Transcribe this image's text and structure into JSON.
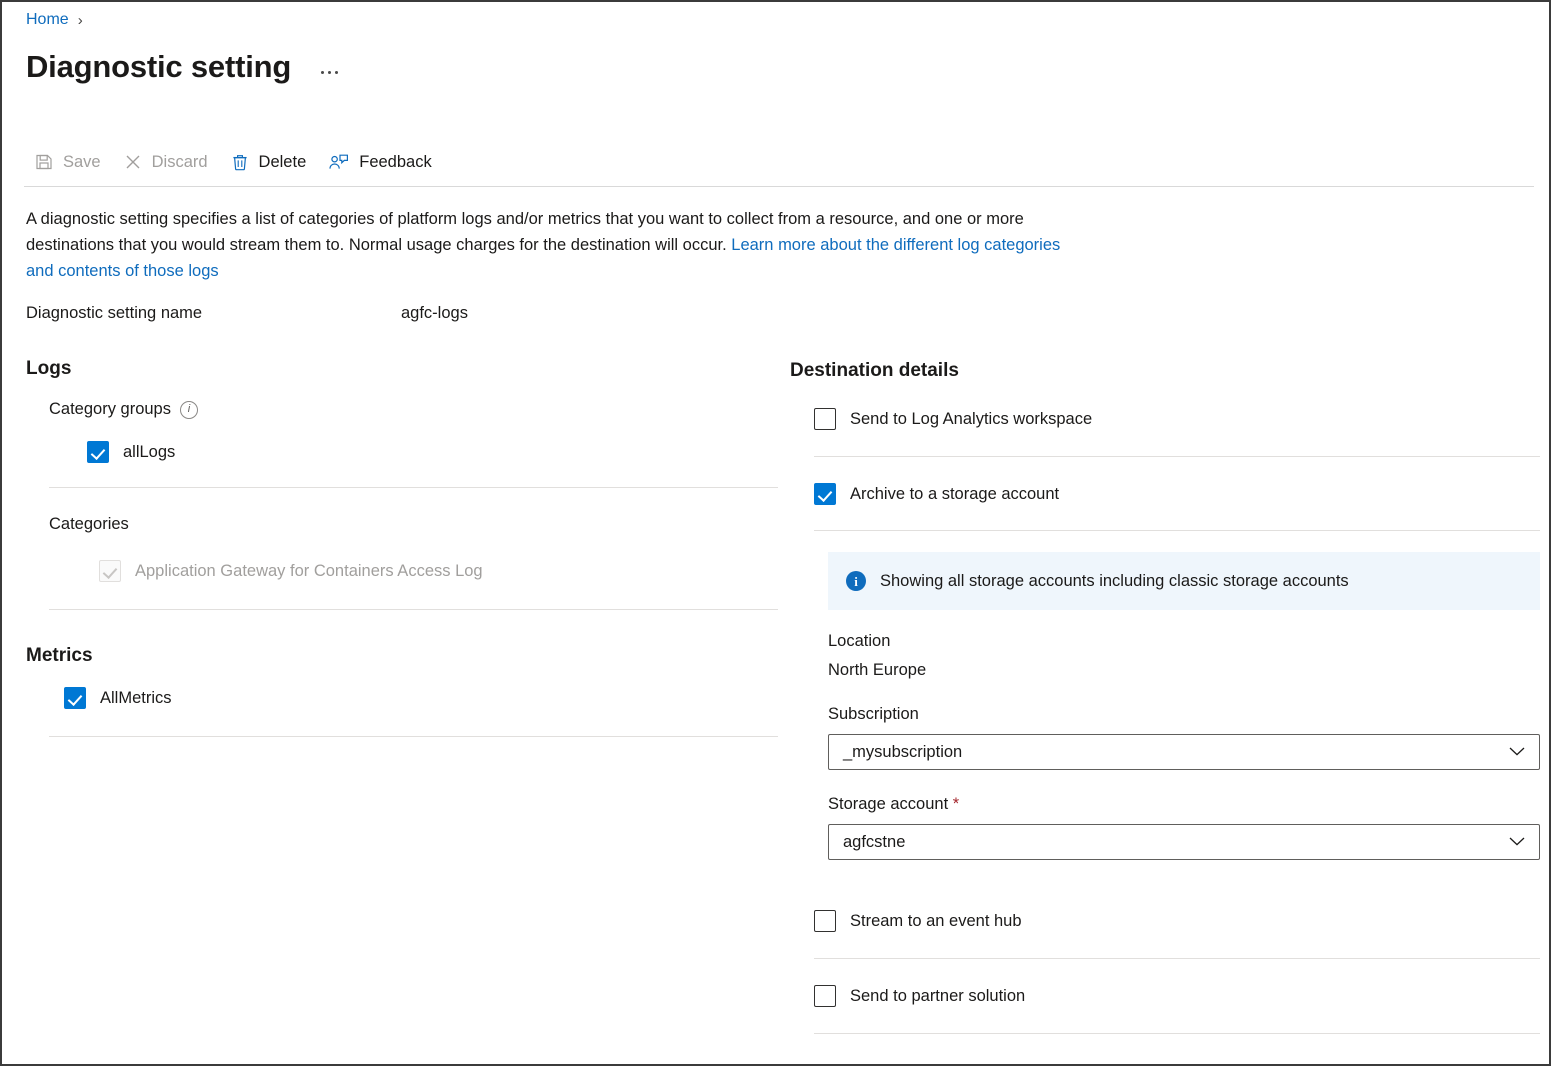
{
  "breadcrumb": {
    "home": "Home",
    "separator": "›"
  },
  "header": {
    "title": "Diagnostic setting",
    "more_label": "More"
  },
  "toolbar": {
    "save": "Save",
    "discard": "Discard",
    "delete": "Delete",
    "feedback": "Feedback"
  },
  "description": {
    "part1": "A diagnostic setting specifies a list of categories of platform logs and/or metrics that you want to collect from a resource, and one or more destinations that you would stream them to. Normal usage charges for the destination will occur. ",
    "link": "Learn more about the different log categories and contents of those logs"
  },
  "setting_name": {
    "label": "Diagnostic setting name",
    "value": "agfc-logs"
  },
  "logs": {
    "heading": "Logs",
    "category_groups_label": "Category groups",
    "info_glyph": "i",
    "category_groups": [
      {
        "label": "allLogs",
        "checked": true,
        "disabled": false
      }
    ],
    "categories_label": "Categories",
    "categories": [
      {
        "label": "Application Gateway for Containers Access Log",
        "checked": true,
        "disabled": true
      }
    ]
  },
  "metrics": {
    "heading": "Metrics",
    "items": [
      {
        "label": "AllMetrics",
        "checked": true,
        "disabled": false
      }
    ]
  },
  "destination": {
    "heading": "Destination details",
    "log_analytics": {
      "label": "Send to Log Analytics workspace",
      "checked": false
    },
    "archive_storage": {
      "label": "Archive to a storage account",
      "checked": true
    },
    "banner": {
      "icon_glyph": "i",
      "text": "Showing all storage accounts including classic storage accounts"
    },
    "location_label": "Location",
    "location_value": "North Europe",
    "subscription_label": "Subscription",
    "subscription_value": "_mysubscription",
    "storage_account_label": "Storage account",
    "storage_account_required_mark": "*",
    "storage_account_value": "agfcstne",
    "event_hub": {
      "label": "Stream to an event hub",
      "checked": false
    },
    "partner_solution": {
      "label": "Send to partner solution",
      "checked": false
    }
  },
  "colors": {
    "accent": "#0078d4",
    "link": "#0f6cbd",
    "banner_bg": "#eff6fc",
    "required": "#a4262c",
    "disabled_text": "#a19f9d"
  }
}
